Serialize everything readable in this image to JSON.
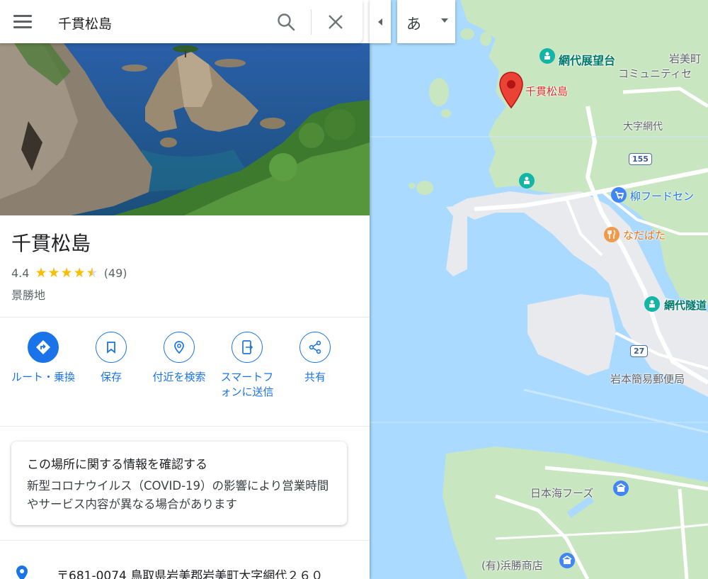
{
  "search": {
    "value": "千貫松島",
    "placeholder": ""
  },
  "place": {
    "title": "千貫松島",
    "rating": "4.4",
    "rating_fraction": 0.88,
    "review_count": "(49)",
    "category": "景勝地"
  },
  "actions": [
    {
      "label": "ルート・乗換",
      "icon": "directions-icon"
    },
    {
      "label": "保存",
      "icon": "bookmark-icon"
    },
    {
      "label": "付近を検索",
      "icon": "nearby-icon"
    },
    {
      "label": "スマートフォンに送信",
      "icon": "send-to-phone-icon"
    },
    {
      "label": "共有",
      "icon": "share-icon"
    }
  ],
  "confirm_card": {
    "title": "この場所に関する情報を確認する",
    "body": "新型コロナウイルス（COVID-19）の影響により営業時間やサービス内容が異なる場合があります"
  },
  "address": {
    "text": "〒681-0074 鳥取県岩美郡岩美町大字網代２６０"
  },
  "language_button": {
    "label": "あ"
  },
  "map": {
    "labels": {
      "ajiro_observatory": "網代展望台",
      "iwami_community": "岩美町",
      "iwami_community_2": "コミュニティセ",
      "senganmatsushima": "千貫松島",
      "oaza_ajiro": "大字網代",
      "yanagi_food": "柳フードセン",
      "nadabata": "なだばた",
      "ajiro_tunnel": "網代隧道",
      "iwamoto_post": "岩本簡易郵便局",
      "nihonkai_foods": "日本海フーズ",
      "hamakatsu_shoten": "(有)浜勝商店"
    },
    "routes": [
      "155",
      "27"
    ]
  },
  "colors": {
    "accent": "#1a73e8",
    "star": "#fbbc04",
    "water": "#aadaff",
    "land": "#c8e6c0",
    "pin": "#ea4335",
    "poi_teal": "#00796b"
  }
}
